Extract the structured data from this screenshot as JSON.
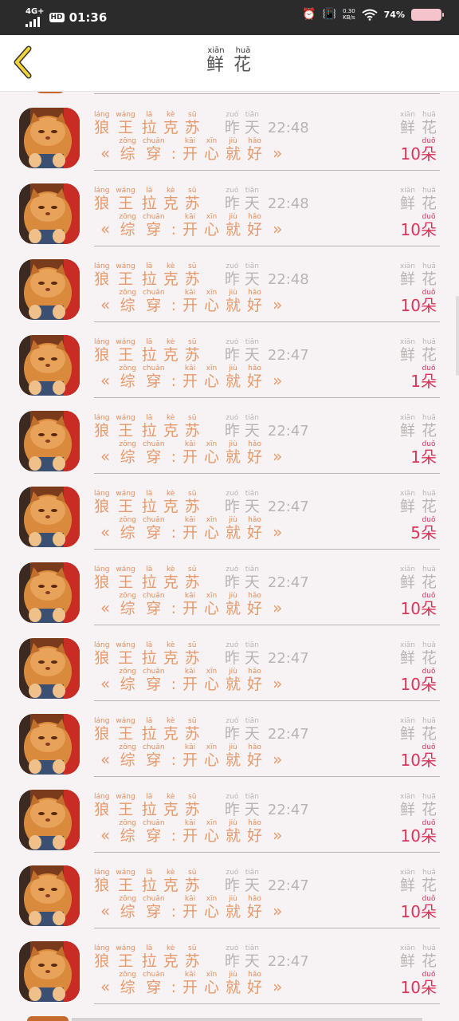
{
  "status_bar": {
    "network": "4G+",
    "hd": "HD",
    "time": "01:36",
    "speed_value": "0.30",
    "speed_unit": "KB/s",
    "battery": "74%"
  },
  "header": {
    "title_chars": [
      {
        "char": "鲜",
        "pinyin": "xiān"
      },
      {
        "char": "花",
        "pinyin": "huā"
      }
    ]
  },
  "rows": [
    {
      "time": "22:48",
      "count": "10"
    },
    {
      "time": "22:48",
      "count": "10"
    },
    {
      "time": "22:48",
      "count": "10"
    },
    {
      "time": "22:47",
      "count": "1"
    },
    {
      "time": "22:47",
      "count": "1"
    },
    {
      "time": "22:47",
      "count": "5"
    },
    {
      "time": "22:47",
      "count": "10"
    },
    {
      "time": "22:47",
      "count": "10"
    },
    {
      "time": "22:47",
      "count": "10"
    },
    {
      "time": "22:47",
      "count": "10"
    },
    {
      "time": "22:47",
      "count": "10"
    },
    {
      "time": "22:47",
      "count": "10"
    }
  ],
  "row_template": {
    "name": [
      {
        "char": "狼",
        "pinyin": "láng"
      },
      {
        "char": "王",
        "pinyin": "wáng"
      },
      {
        "char": "拉",
        "pinyin": "lā"
      },
      {
        "char": "克",
        "pinyin": "kè"
      },
      {
        "char": "苏",
        "pinyin": "sū"
      }
    ],
    "when": [
      {
        "char": "昨",
        "pinyin": "zuó"
      },
      {
        "char": "天",
        "pinyin": "tiān"
      }
    ],
    "open_quote": "«",
    "close_quote": "»",
    "message": [
      {
        "char": "综",
        "pinyin": "zōng"
      },
      {
        "char": "穿",
        "pinyin": "chuān"
      },
      {
        "char": ":",
        "pinyin": ""
      },
      {
        "char": "开",
        "pinyin": "kāi"
      },
      {
        "char": "心",
        "pinyin": "xīn"
      },
      {
        "char": "就",
        "pinyin": "jiù"
      },
      {
        "char": "好",
        "pinyin": "hǎo"
      }
    ],
    "gift": [
      {
        "char": "鲜",
        "pinyin": "xiān"
      },
      {
        "char": "花",
        "pinyin": "huā"
      }
    ],
    "unit": {
      "char": "朵",
      "pinyin": "duǒ"
    }
  },
  "colors": {
    "accent_orange": "#e49a6c",
    "count_red": "#d9345a",
    "muted_gray": "#b8b4b4",
    "back_arrow": "#f1d23a"
  }
}
